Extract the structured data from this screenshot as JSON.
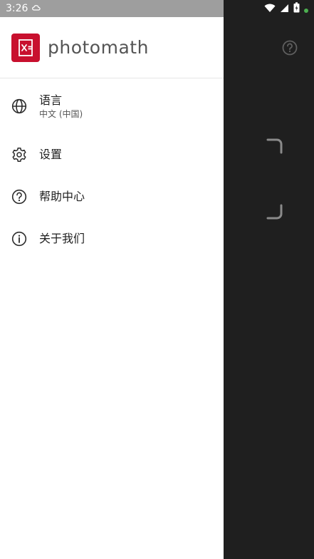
{
  "status_bar": {
    "time": "3:26",
    "icons": [
      "cloud-icon",
      "wifi-icon",
      "signal-icon",
      "battery-icon",
      "dot-icon"
    ],
    "dot_color": "#4caf50"
  },
  "drawer": {
    "brand": "photomath",
    "brand_color": "#c8102e",
    "items": [
      {
        "icon": "globe-icon",
        "label": "语言",
        "sublabel": "中文 (中国)"
      },
      {
        "icon": "gear-icon",
        "label": "设置"
      },
      {
        "icon": "help-circle-icon",
        "label": "帮助中心"
      },
      {
        "icon": "info-icon",
        "label": "关于我们"
      }
    ]
  },
  "camera": {
    "help_icon": "help-circle-icon"
  }
}
